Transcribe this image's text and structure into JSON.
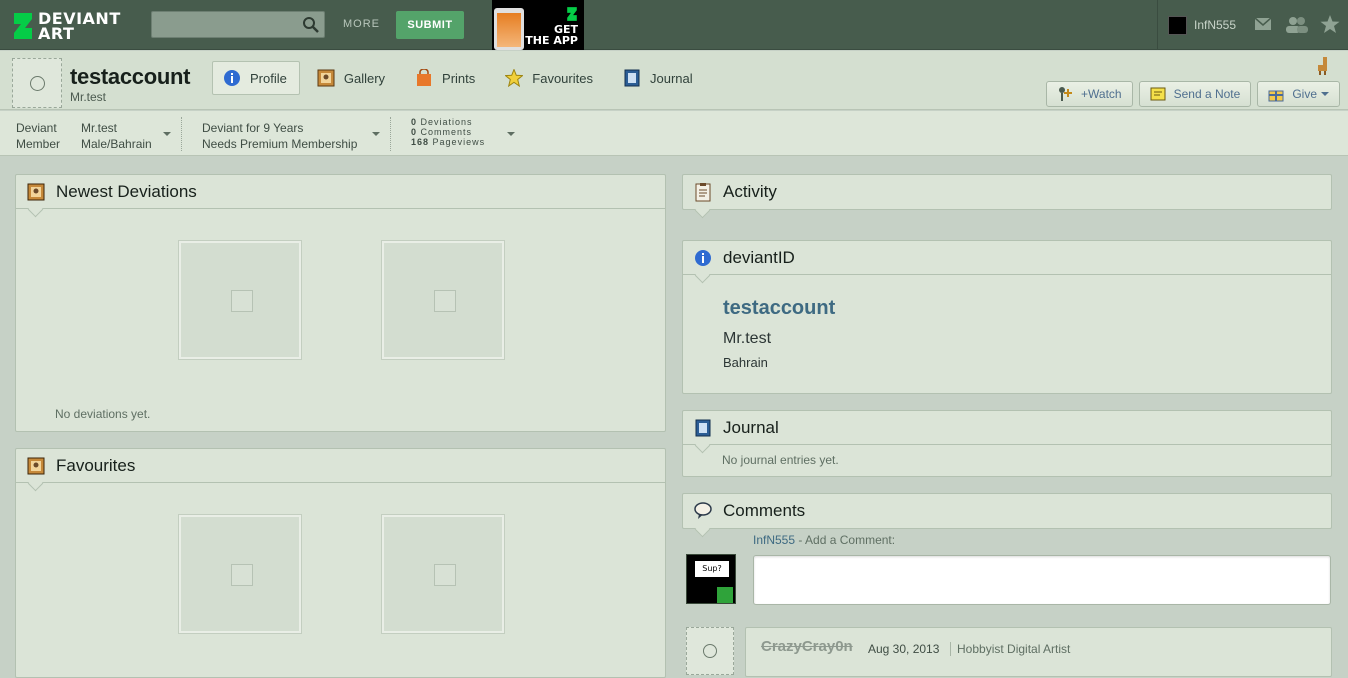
{
  "topbar": {
    "logo_line1": "DEVIANT",
    "logo_line2": "ART",
    "search_placeholder": "",
    "more_label": "MORE",
    "submit_label": "SUBMIT",
    "app_line1": "GET",
    "app_line2": "THE APP",
    "username": "InfN555"
  },
  "profile": {
    "username": "testaccount",
    "tagline": "Mr.test",
    "tabs": [
      {
        "label": "Profile",
        "icon": "info-icon"
      },
      {
        "label": "Gallery",
        "icon": "gallery-icon"
      },
      {
        "label": "Prints",
        "icon": "prints-icon"
      },
      {
        "label": "Favourites",
        "icon": "star-icon"
      },
      {
        "label": "Journal",
        "icon": "journal-icon"
      }
    ],
    "actions": {
      "watch": "+Watch",
      "note": "Send a Note",
      "give": "Give"
    }
  },
  "infobar": {
    "role_line1": "Deviant",
    "role_line2": "Member",
    "name_line1": "Mr.test",
    "name_line2": "Male/Bahrain",
    "since_line1": "Deviant for 9 Years",
    "since_line2": "Needs Premium Membership",
    "stats": [
      {
        "count": "0",
        "label": "Deviations"
      },
      {
        "count": "0",
        "label": "Comments"
      },
      {
        "count": "168",
        "label": "Pageviews"
      }
    ]
  },
  "left": {
    "newest_title": "Newest Deviations",
    "newest_empty": "No deviations yet.",
    "fav_title": "Favourites"
  },
  "right": {
    "activity_title": "Activity",
    "deviantid_title": "deviantID",
    "deviantid_name": "testaccount",
    "deviantid_real": "Mr.test",
    "deviantid_location": "Bahrain",
    "journal_title": "Journal",
    "journal_empty": "No journal entries yet.",
    "comments_title": "Comments",
    "comment_user": "InfN555",
    "comment_prompt": "- Add a Comment:",
    "comment_avatar_text": "Sup?",
    "comment2_user": "CrazyCray0n",
    "comment2_date": "Aug 30, 2013",
    "comment2_role": "Hobbyist Digital Artist"
  },
  "colors": {
    "topbar": "#475c4d",
    "submit": "#54a36a",
    "link": "#3e6a82",
    "background": "#c6d1c6"
  }
}
